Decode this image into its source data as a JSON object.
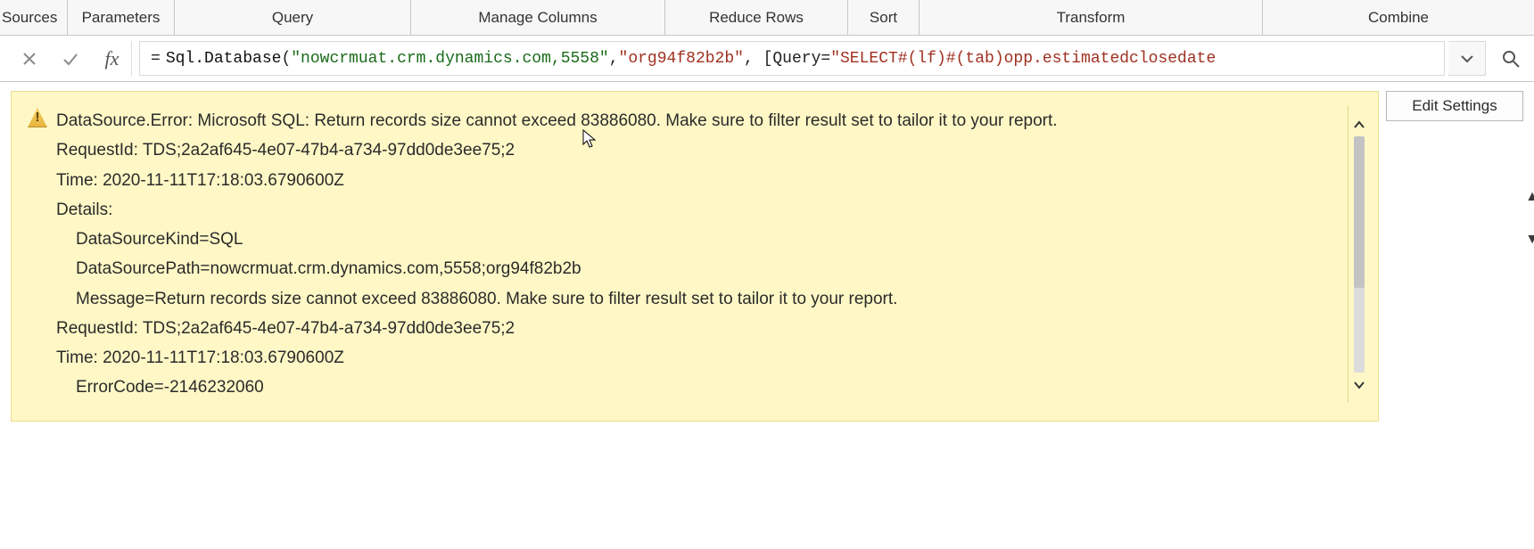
{
  "ribbon": {
    "sources": "Sources",
    "parameters": "Parameters",
    "query": "Query",
    "manage_columns": "Manage Columns",
    "reduce_rows": "Reduce Rows",
    "sort": "Sort",
    "transform": "Transform",
    "combine": "Combine"
  },
  "formula_bar": {
    "fx_label": "fx",
    "equals": "=",
    "func": "Sql.Database",
    "open": "(",
    "arg1": "\"nowcrmuat.crm.dynamics.com,5558\"",
    "sep1": ", ",
    "arg2": "\"org94f82b2b\"",
    "sep2": ", [Query=",
    "arg3": "\"SELECT#(lf)#(tab)opp.estimatedclosedate"
  },
  "error": {
    "line1": "DataSource.Error: Microsoft SQL: Return records size cannot exceed 83886080. Make sure to filter result set to tailor it to your report.",
    "line2": "RequestId: TDS;2a2af645-4e07-47b4-a734-97dd0de3ee75;2",
    "line3": "Time: 2020-11-11T17:18:03.6790600Z",
    "line4": "Details:",
    "line5": "DataSourceKind=SQL",
    "line6": "DataSourcePath=nowcrmuat.crm.dynamics.com,5558;org94f82b2b",
    "line7": "Message=Return records size cannot exceed 83886080. Make sure to filter result set to tailor it to your report.",
    "line8": "RequestId: TDS;2a2af645-4e07-47b4-a734-97dd0de3ee75;2",
    "line9": "Time: 2020-11-11T17:18:03.6790600Z",
    "line10": "ErrorCode=-2146232060"
  },
  "buttons": {
    "edit_settings": "Edit Settings"
  }
}
